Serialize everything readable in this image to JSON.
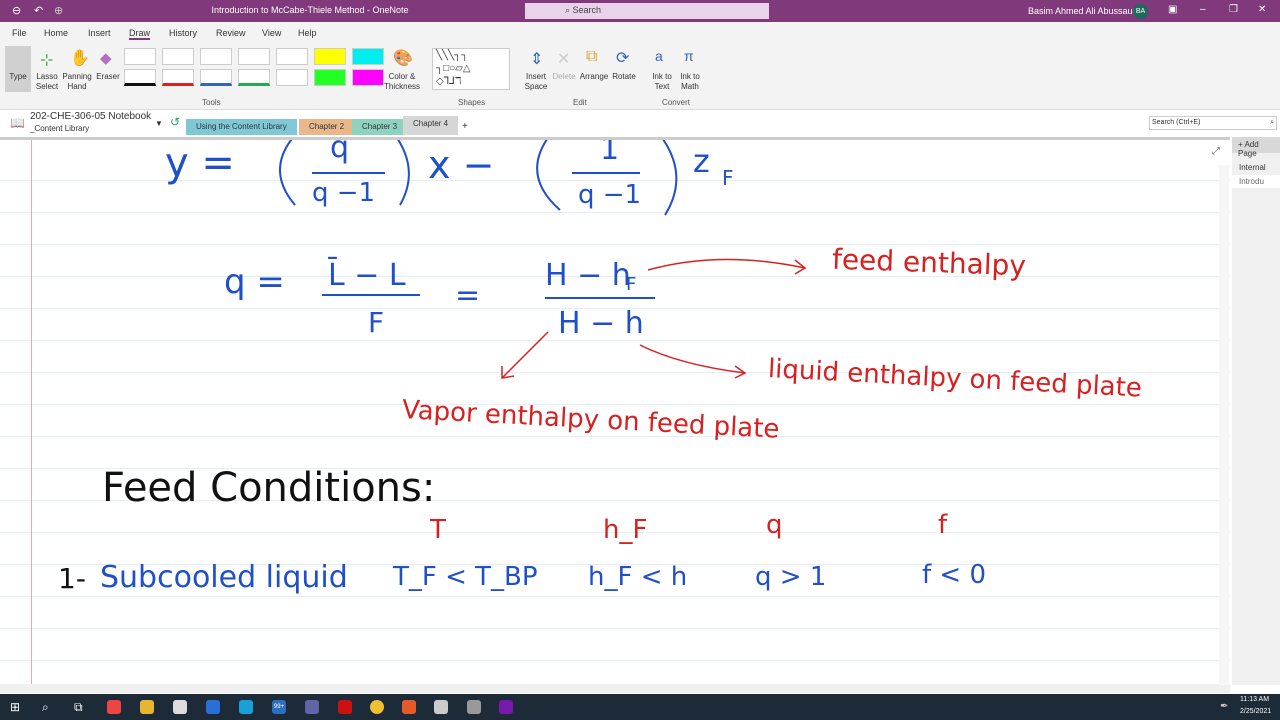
{
  "window": {
    "title": "Introduction to McCabe-Thiele Method - OneNote",
    "search_placeholder": "Search",
    "user": "Basim Ahmed Ali Abussaud",
    "initials": "BA"
  },
  "menu": [
    "File",
    "Home",
    "Insert",
    "Draw",
    "History",
    "Review",
    "View",
    "Help"
  ],
  "active_menu": "Draw",
  "ribbon": {
    "tools": [
      "Type",
      "Lasso Select",
      "Panning Hand",
      "Eraser"
    ],
    "color_thickness": "Color & Thickness",
    "group_tools": "Tools",
    "group_shapes": "Shapes",
    "edit": [
      "Insert Space",
      "Delete",
      "Arrange",
      "Rotate"
    ],
    "group_edit": "Edit",
    "convert": [
      "Ink to Text",
      "Ink to Math"
    ],
    "group_convert": "Convert"
  },
  "notebook": {
    "name": "202-CHE-306-05 Notebook",
    "section": "_Content Library",
    "tabs": [
      {
        "label": "Using the Content Library",
        "color": "#7fc8d6"
      },
      {
        "label": "Chapter 2",
        "color": "#e8b88a"
      },
      {
        "label": "Chapter 3",
        "color": "#8ed3c0"
      },
      {
        "label": "Chapter 4",
        "color": "#d6d6d6"
      }
    ],
    "add_tab": "+",
    "search_placeholder": "Search (Ctrl+E)"
  },
  "pages": {
    "add_page": "Add Page",
    "items": [
      "Internal",
      "Introdu"
    ]
  },
  "ink": {
    "eq1": "y = ( q⁄q−1 ) x − ( 1⁄q−1 ) z_F",
    "eq1_parts": [
      "y  =",
      "q",
      "q −1",
      "x  −",
      "1",
      "q −1",
      "z",
      "F"
    ],
    "eq2_parts": [
      "q  =",
      "L̄ − L",
      "F",
      "=",
      "H − h",
      "F",
      "H − h"
    ],
    "feed_enthalpy": "feed enthalpy",
    "liquid_enthalpy": "liquid enthalpy on feed plate",
    "vapor_enthalpy": "Vapor enthalpy on feed plate",
    "feed_conditions": "Feed Conditions:",
    "headers": [
      "T",
      "h_F",
      "q",
      "f"
    ],
    "row1": {
      "num": "1-",
      "name": "Subcooled liquid",
      "T": "T_F < T_BP",
      "h": "h_F < h",
      "q": "q > 1",
      "f": "f < 0"
    }
  },
  "colors": {
    "accent": "#80397b",
    "ink_blue": "#1f4fc9",
    "ink_red": "#d92020"
  },
  "taskbar": {
    "time": "11:13 AM",
    "date": "2/25/2021",
    "badge": "99+"
  }
}
